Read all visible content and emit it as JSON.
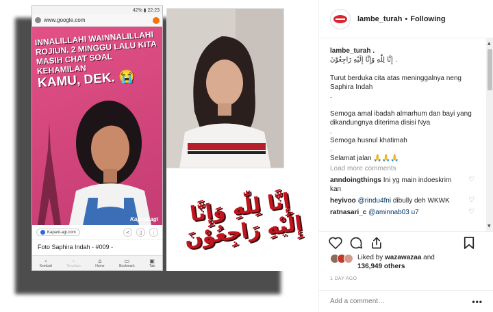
{
  "post_image": {
    "phone": {
      "status_left": "",
      "status_right": "42% ▮ 22:23",
      "url": "www.google.com",
      "caption_line1": "INNALILLAHI WAINNALILLAHI",
      "caption_line2": "ROJIUN. 2 MINGGU LALU KITA",
      "caption_line3": "MASIH CHAT SOAL KEHAMILAN",
      "caption_big": "KAMU, DEK. 😭",
      "watermark": "KapanLagi",
      "chip_label": "KapanLagi.com",
      "page_title": "Foto Saphira Indah - #009 -",
      "nav": [
        {
          "icon": "‹",
          "label": "Kembali"
        },
        {
          "icon": "›",
          "label": "Teruskan"
        },
        {
          "icon": "⌂",
          "label": "Home"
        },
        {
          "icon": "▭",
          "label": "Bookmark"
        },
        {
          "icon": "▣",
          "label": "Tab"
        }
      ]
    },
    "arabic_text": "إِنَّا لِلّٰهِ وَإِنَّا إِلَيْهِ رَاجِعُوْنَ"
  },
  "header": {
    "username": "lambe_turah",
    "separator": "•",
    "follow_status": "Following"
  },
  "caption": {
    "username": "lambe_turah .",
    "arabic": "إِنَّا لِلّٰهِ وَإِنَّا إِلَيْهِ رَاجِعُوْنَ .",
    "para1": "Turut berduka cita atas meninggalnya neng Saphira Indah",
    "dot1": ".",
    "para2": "Semoga amal ibadah almarhum dan bayi yang dikandungnya diterima disisi Nya",
    "dot2": ".",
    "para3": "Semoga husnul khatimah",
    "dot3": ".",
    "para4": "Selamat jalan 🙏🙏🙏"
  },
  "load_more": "Load more comments",
  "comments": [
    {
      "user": "anndoingthings",
      "text": "Ini yg main indoeskrim kan",
      "mention": ""
    },
    {
      "user": "heyivoo",
      "text": " dibully deh WKWK",
      "mention": "@rindu4fni"
    },
    {
      "user": "ratnasari_c",
      "text": "",
      "mention": "@aminnab03 u7"
    }
  ],
  "likes": {
    "prefix": "Liked by ",
    "user": "wazawazaa",
    "middle": " and",
    "count": "136,949 others"
  },
  "timestamp": "1 DAY AGO",
  "add_comment_placeholder": "Add a comment…",
  "more_label": "•••",
  "colors": {
    "accent_red": "#d9262e",
    "text": "#262626",
    "muted": "#999999",
    "mention": "#003569"
  }
}
